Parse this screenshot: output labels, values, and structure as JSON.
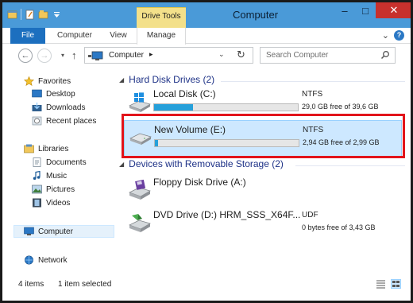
{
  "window": {
    "title": "Computer",
    "contextual_tab_group": "Drive Tools",
    "controls": {
      "minimize": "–",
      "maximize": "□",
      "close": "✕"
    }
  },
  "ribbon": {
    "tabs": [
      {
        "label": "File"
      },
      {
        "label": "Computer"
      },
      {
        "label": "View"
      },
      {
        "label": "Manage"
      }
    ],
    "expand_glyph": "⌄",
    "help_glyph": "?"
  },
  "address_bar": {
    "back_glyph": "←",
    "forward_glyph": "→",
    "recent_glyph": "▾",
    "up_glyph": "↑",
    "location": "Computer",
    "crumb_arrow": "▸",
    "dropdown_glyph": "⌄",
    "refresh_glyph": "↻",
    "search_placeholder": "Search Computer"
  },
  "nav_pane": {
    "favorites": {
      "label": "Favorites",
      "items": [
        {
          "label": "Desktop",
          "icon": "desktop-icon"
        },
        {
          "label": "Downloads",
          "icon": "downloads-icon"
        },
        {
          "label": "Recent places",
          "icon": "recent-places-icon"
        }
      ]
    },
    "libraries": {
      "label": "Libraries",
      "items": [
        {
          "label": "Documents",
          "icon": "documents-icon"
        },
        {
          "label": "Music",
          "icon": "music-icon"
        },
        {
          "label": "Pictures",
          "icon": "pictures-icon"
        },
        {
          "label": "Videos",
          "icon": "videos-icon"
        }
      ]
    },
    "computer": {
      "label": "Computer"
    },
    "network": {
      "label": "Network"
    }
  },
  "content": {
    "groups": [
      {
        "header": "Hard Disk Drives (2)",
        "drives": [
          {
            "name": "Local Disk (C:)",
            "filesystem": "NTFS",
            "free_text": "29,0 GB free of 39,6 GB",
            "used_fraction": 0.27,
            "selected": false
          },
          {
            "name": "New Volume (E:)",
            "filesystem": "NTFS",
            "free_text": "2,94 GB free of 2,99 GB",
            "used_fraction": 0.02,
            "selected": true
          }
        ]
      },
      {
        "header": "Devices with Removable Storage (2)",
        "drives": [
          {
            "name": "Floppy Disk Drive (A:)"
          },
          {
            "name": "DVD Drive (D:) HRM_SSS_X64F...",
            "filesystem": "UDF",
            "free_text": "0 bytes free of 3,43 GB"
          }
        ]
      }
    ]
  },
  "status_bar": {
    "item_count": "4 items",
    "selection": "1 item selected"
  },
  "colors": {
    "titlebar": "#4a9ad8",
    "accent": "#1c6fbf",
    "drive_tools": "#f3e08a",
    "selection": "#cde8ff",
    "usage_bar": "#26a0da",
    "highlight": "#e2141b"
  }
}
